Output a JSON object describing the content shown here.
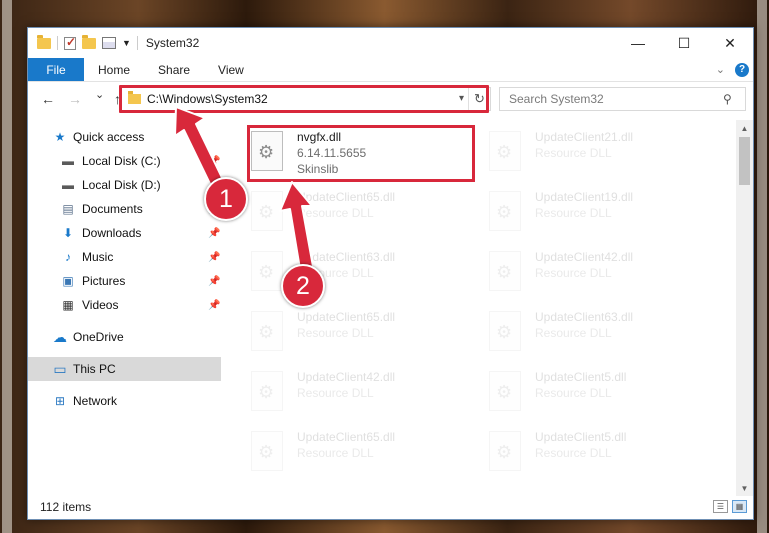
{
  "window": {
    "title": "System32",
    "minimize_glyph": "—",
    "maximize_glyph": "☐",
    "close_glyph": "✕"
  },
  "ribbon": {
    "file": "File",
    "tabs": [
      "Home",
      "Share",
      "View"
    ],
    "help_glyph": "?"
  },
  "nav": {
    "back_glyph": "←",
    "forward_glyph": "→",
    "recent_glyph": "⌄",
    "up_glyph": "↑"
  },
  "address": {
    "path": "C:\\Windows\\System32",
    "refresh_glyph": "↻"
  },
  "search": {
    "placeholder": "Search System32",
    "icon_glyph": "⚲"
  },
  "sidebar": {
    "items": [
      {
        "label": "Quick access",
        "icon": "star-icon",
        "glyph": "★",
        "color": "#1979ca",
        "pinned": false
      },
      {
        "label": "Local Disk (C:)",
        "icon": "drive-icon",
        "glyph": "▬",
        "color": "#5a5a5a",
        "pinned": true
      },
      {
        "label": "Local Disk (D:)",
        "icon": "drive-icon",
        "glyph": "▬",
        "color": "#5a5a5a",
        "pinned": true
      },
      {
        "label": "Documents",
        "icon": "documents-icon",
        "glyph": "▤",
        "color": "#5a6f8a",
        "pinned": true
      },
      {
        "label": "Downloads",
        "icon": "downloads-icon",
        "glyph": "⬇",
        "color": "#1979ca",
        "pinned": true
      },
      {
        "label": "Music",
        "icon": "music-icon",
        "glyph": "♪",
        "color": "#1979ca",
        "pinned": true
      },
      {
        "label": "Pictures",
        "icon": "pictures-icon",
        "glyph": "▣",
        "color": "#3b78b5",
        "pinned": true
      },
      {
        "label": "Videos",
        "icon": "videos-icon",
        "glyph": "▦",
        "color": "#333333",
        "pinned": true
      },
      {
        "label": "OneDrive",
        "icon": "cloud-icon",
        "glyph": "☁",
        "color": "#1979ca",
        "pinned": false
      },
      {
        "label": "This PC",
        "icon": "computer-icon",
        "glyph": "▭",
        "color": "#2b79c2",
        "pinned": false
      },
      {
        "label": "Network",
        "icon": "network-icon",
        "glyph": "⊞",
        "color": "#2b79c2",
        "pinned": false
      }
    ],
    "pin_glyph": "📌"
  },
  "files": [
    {
      "name": "nvgfx.dll",
      "line1": "6.14.11.5655",
      "line2": "Skinslib",
      "faded": false
    },
    {
      "name": "UpdateClient21.dll",
      "line1": "Resource DLL",
      "line2": "",
      "faded": true
    },
    {
      "name": "UpdateClient65.dll",
      "line1": "Resource DLL",
      "line2": "",
      "faded": true
    },
    {
      "name": "UpdateClient19.dll",
      "line1": "Resource DLL",
      "line2": "",
      "faded": true
    },
    {
      "name": "UpdateClient63.dll",
      "line1": "Resource DLL",
      "line2": "",
      "faded": true
    },
    {
      "name": "UpdateClient42.dll",
      "line1": "Resource DLL",
      "line2": "",
      "faded": true
    },
    {
      "name": "UpdateClient65.dll",
      "line1": "Resource DLL",
      "line2": "",
      "faded": true
    },
    {
      "name": "UpdateClient63.dll",
      "line1": "Resource DLL",
      "line2": "",
      "faded": true
    },
    {
      "name": "UpdateClient42.dll",
      "line1": "Resource DLL",
      "line2": "",
      "faded": true
    },
    {
      "name": "UpdateClient5.dll",
      "line1": "Resource DLL",
      "line2": "",
      "faded": true
    },
    {
      "name": "UpdateClient65.dll",
      "line1": "Resource DLL",
      "line2": "",
      "faded": true
    },
    {
      "name": "UpdateClient5.dll",
      "line1": "Resource DLL",
      "line2": "",
      "faded": true
    }
  ],
  "status": {
    "count": "112 items"
  },
  "annotations": {
    "step1": "1",
    "step2": "2",
    "color": "#d8283b"
  }
}
